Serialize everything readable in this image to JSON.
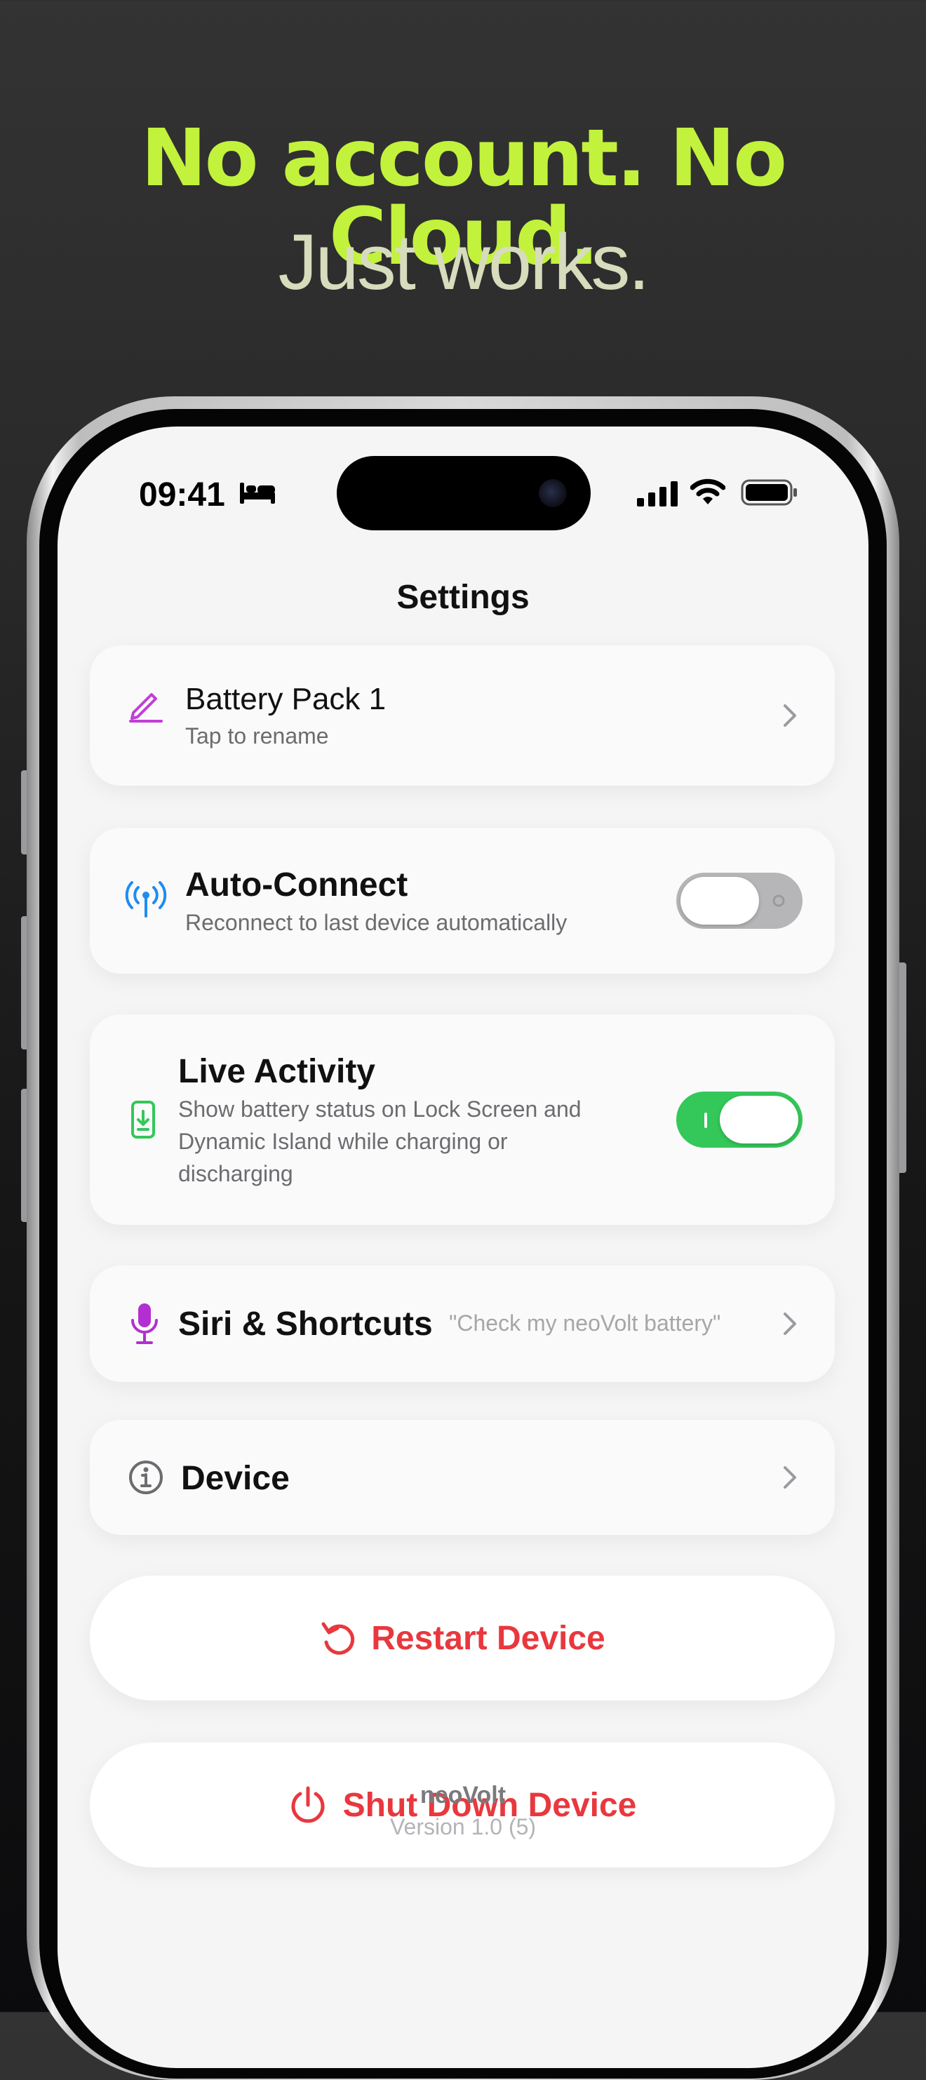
{
  "promo": {
    "headline": "No account.  No Cloud.",
    "subheadline": "Just works."
  },
  "status_bar": {
    "time": "09:41",
    "focus_icon": "bed-icon",
    "signal_icon": "cellular-signal-icon",
    "wifi_icon": "wifi-icon",
    "battery_icon": "battery-icon"
  },
  "nav": {
    "title": "Settings"
  },
  "settings": {
    "battery_pack": {
      "title": "Battery Pack 1",
      "subtitle": "Tap to rename",
      "icon": "pencil-icon"
    },
    "auto_connect": {
      "title": "Auto-Connect",
      "subtitle": "Reconnect to last device automatically",
      "icon": "antenna-icon",
      "enabled": false
    },
    "live_activity": {
      "title": "Live Activity",
      "subtitle_lines": [
        "Show battery status on Lock Screen and",
        "Dynamic Island while charging or",
        "discharging"
      ],
      "icon": "phone-download-icon",
      "enabled": true
    },
    "siri": {
      "title": "Siri & Shortcuts",
      "hint": "\"Check my neoVolt battery\"",
      "icon": "microphone-icon"
    },
    "device": {
      "title": "Device",
      "icon": "info-icon"
    }
  },
  "actions": {
    "restart": {
      "label": "Restart Device",
      "icon": "restart-icon"
    },
    "shutdown": {
      "label": "Shut Down Device",
      "icon": "power-icon"
    }
  },
  "footer": {
    "app_name": "neoVolt",
    "version": "Version 1.0 (5)"
  },
  "colors": {
    "headline": "#c2f23c",
    "subheadline": "#d6dcbc",
    "toggle_on": "#34c759",
    "toggle_off": "#b6b6b8",
    "destructive": "#e8383e",
    "pencil": "#c03fd6",
    "antenna": "#1f8cf0",
    "live_activity_icon": "#34c759",
    "microphone": "#b32fd2"
  }
}
